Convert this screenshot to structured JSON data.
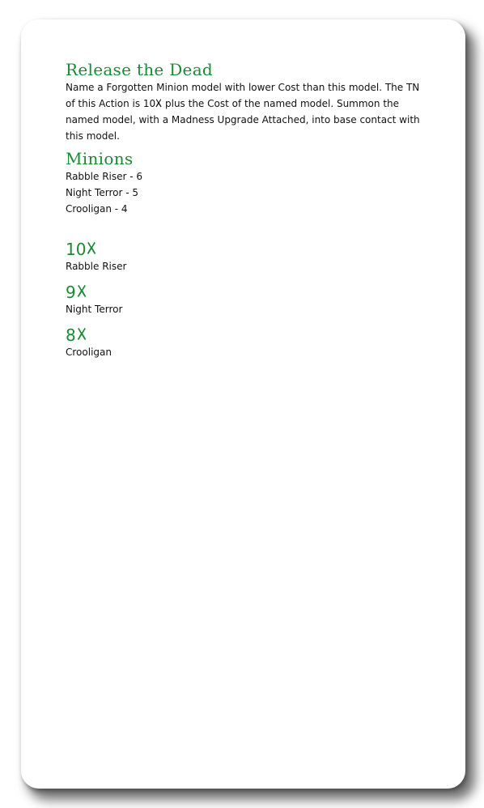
{
  "ability": {
    "title": "Release the Dead",
    "text_before_icon": "Name a Forgotten Minion model with lower Cost than this model. The TN of this Action is 10",
    "text_after_icon": " plus the Cost of the named model. Summon the named model, with a Madness Upgrade Attached, into base contact with this model.",
    "suit_icon": "mask-suit-icon"
  },
  "minions": {
    "title": "Minions",
    "items": [
      "Rabble Riser - 6",
      "Night Terror - 5",
      "Crooligan - 4"
    ]
  },
  "tn_list": [
    {
      "value": "10",
      "name": "Rabble Riser"
    },
    {
      "value": "9",
      "name": "Night Terror"
    },
    {
      "value": "8",
      "name": "Crooligan"
    }
  ],
  "colors": {
    "accent": "#1b8a35",
    "text": "#111111",
    "background": "#ffffff"
  }
}
